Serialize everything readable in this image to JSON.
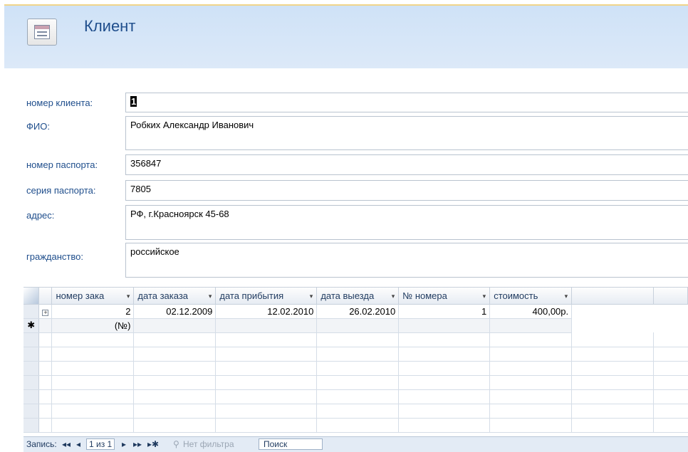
{
  "form": {
    "title": "Клиент",
    "fields": [
      {
        "label": "номер клиента:",
        "value": "1"
      },
      {
        "label": "ФИО:",
        "value": "Робких Александр Иванович"
      },
      {
        "label": "номер паспорта:",
        "value": "356847"
      },
      {
        "label": "серия паспорта:",
        "value": "7805"
      },
      {
        "label": "адрес:",
        "value": "РФ, г.Красноярск 45-68"
      },
      {
        "label": "гражданство:",
        "value": "российское"
      }
    ]
  },
  "subform": {
    "columns": [
      {
        "label": "номер зака",
        "dd": "▾"
      },
      {
        "label": "дата заказа",
        "dd": "▾"
      },
      {
        "label": "дата прибытия",
        "dd": "▾"
      },
      {
        "label": "дата выезда",
        "dd": "▾"
      },
      {
        "label": "№ номера",
        "dd": "▾"
      },
      {
        "label": "стоимость",
        "dd": "▾"
      }
    ],
    "rows": [
      {
        "expand": "+",
        "order_no": "2",
        "order_date": "02.12.2009",
        "arrival": "12.02.2010",
        "departure": "26.02.2010",
        "room_no": "1",
        "cost": "400,00р."
      }
    ],
    "new_row": {
      "marker": "✱",
      "placeholder": "(№)"
    }
  },
  "nav": {
    "record_label": "Запись:",
    "first": "◂◂",
    "prev": "◂",
    "position": "1 из 1",
    "next": "▸",
    "last": "▸▸",
    "new": "▸✱",
    "filter": "Нет фильтра",
    "search": "Поиск"
  }
}
